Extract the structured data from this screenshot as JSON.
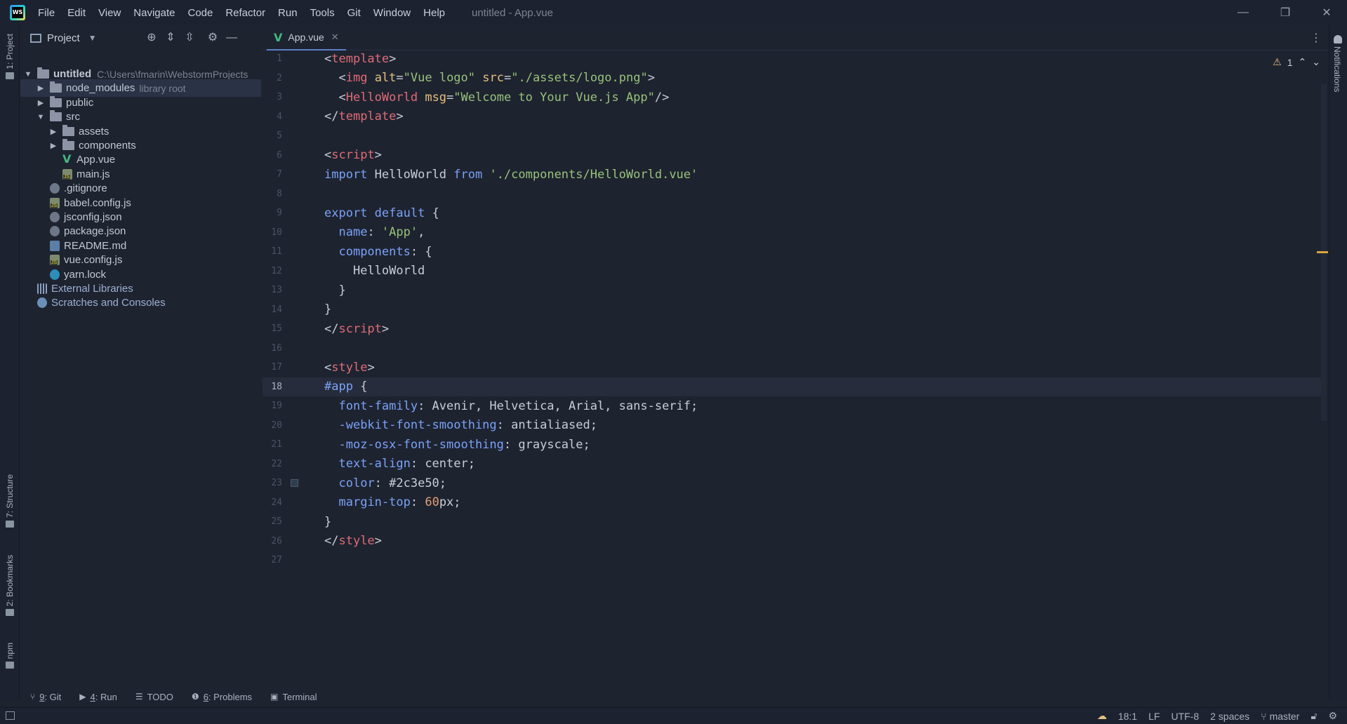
{
  "window": {
    "title": "untitled - App.vue",
    "menu": [
      "File",
      "Edit",
      "View",
      "Navigate",
      "Code",
      "Refactor",
      "Run",
      "Tools",
      "Git",
      "Window",
      "Help"
    ],
    "controls": {
      "minimize": "—",
      "restore": "❐",
      "close": "✕"
    }
  },
  "left_strip": {
    "project": "1: Project",
    "structure": "7: Structure",
    "bookmarks": "2: Bookmarks",
    "npm": "npm"
  },
  "project_panel": {
    "title": "Project",
    "tree": [
      {
        "label": "untitled",
        "extra": "C:\\Users\\fmarin\\WebstormProjects",
        "type": "folder",
        "depth": 0,
        "expanded": true
      },
      {
        "label": "node_modules",
        "extra": "library root",
        "type": "folder",
        "depth": 1,
        "expanded": false,
        "selected": true
      },
      {
        "label": "public",
        "type": "folder",
        "depth": 1,
        "expanded": false
      },
      {
        "label": "src",
        "type": "folder",
        "depth": 1,
        "expanded": true
      },
      {
        "label": "assets",
        "type": "folder",
        "depth": 2,
        "expanded": false
      },
      {
        "label": "components",
        "type": "folder",
        "depth": 2,
        "expanded": false
      },
      {
        "label": "App.vue",
        "type": "vue",
        "depth": 2
      },
      {
        "label": "main.js",
        "type": "js",
        "depth": 2
      },
      {
        "label": ".gitignore",
        "type": "cfg",
        "depth": 1
      },
      {
        "label": "babel.config.js",
        "type": "js",
        "depth": 1
      },
      {
        "label": "jsconfig.json",
        "type": "cfg",
        "depth": 1
      },
      {
        "label": "package.json",
        "type": "cfg",
        "depth": 1
      },
      {
        "label": "README.md",
        "type": "md",
        "depth": 1
      },
      {
        "label": "vue.config.js",
        "type": "js",
        "depth": 1
      },
      {
        "label": "yarn.lock",
        "type": "yarn",
        "depth": 1
      },
      {
        "label": "External Libraries",
        "type": "lib",
        "depth": 0
      },
      {
        "label": "Scratches and Consoles",
        "type": "scratch",
        "depth": 0
      }
    ]
  },
  "editor": {
    "tab_label": "App.vue",
    "inspection_count": "1",
    "current_line": 18,
    "lines": [
      [
        [
          "tok-br",
          "<"
        ],
        [
          "tok-tag",
          "template"
        ],
        [
          "tok-br",
          ">"
        ]
      ],
      [
        [
          "tok-br",
          "  <"
        ],
        [
          "tok-tag",
          "img"
        ],
        [
          "tok-br",
          " "
        ],
        [
          "tok-attr",
          "alt"
        ],
        [
          "tok-br",
          "="
        ],
        [
          "tok-str",
          "\"Vue logo\""
        ],
        [
          "tok-br",
          " "
        ],
        [
          "tok-attr",
          "src"
        ],
        [
          "tok-br",
          "="
        ],
        [
          "tok-str",
          "\"./assets/logo.png\""
        ],
        [
          "tok-br",
          ">"
        ]
      ],
      [
        [
          "tok-br",
          "  <"
        ],
        [
          "tok-tag",
          "HelloWorld"
        ],
        [
          "tok-br",
          " "
        ],
        [
          "tok-attr",
          "msg"
        ],
        [
          "tok-br",
          "="
        ],
        [
          "tok-str",
          "\"Welcome to Your Vue.js App\""
        ],
        [
          "tok-br",
          "/>"
        ]
      ],
      [
        [
          "tok-br",
          "</"
        ],
        [
          "tok-tag",
          "template"
        ],
        [
          "tok-br",
          ">"
        ]
      ],
      [],
      [
        [
          "tok-br",
          "<"
        ],
        [
          "tok-tag",
          "script"
        ],
        [
          "tok-br",
          ">"
        ]
      ],
      [
        [
          "tok-kw",
          "import"
        ],
        [
          "tok-br",
          " HelloWorld "
        ],
        [
          "tok-kw",
          "from"
        ],
        [
          "tok-br",
          " "
        ],
        [
          "tok-str",
          "'./components/HelloWorld.vue'"
        ]
      ],
      [],
      [
        [
          "tok-kw",
          "export"
        ],
        [
          "tok-br",
          " "
        ],
        [
          "tok-kw",
          "default"
        ],
        [
          "tok-br",
          " {"
        ]
      ],
      [
        [
          "tok-br",
          "  "
        ],
        [
          "tok-prop",
          "name"
        ],
        [
          "tok-br",
          ": "
        ],
        [
          "tok-str",
          "'App'"
        ],
        [
          "tok-br",
          ","
        ]
      ],
      [
        [
          "tok-br",
          "  "
        ],
        [
          "tok-prop",
          "components"
        ],
        [
          "tok-br",
          ": {"
        ]
      ],
      [
        [
          "tok-br",
          "    HelloWorld"
        ]
      ],
      [
        [
          "tok-br",
          "  }"
        ]
      ],
      [
        [
          "tok-br",
          "}"
        ]
      ],
      [
        [
          "tok-br",
          "</"
        ],
        [
          "tok-tag",
          "script"
        ],
        [
          "tok-br",
          ">"
        ]
      ],
      [],
      [
        [
          "tok-br",
          "<"
        ],
        [
          "tok-tag",
          "style"
        ],
        [
          "tok-br",
          ">"
        ]
      ],
      [
        [
          "tok-sel",
          "#app"
        ],
        [
          "tok-br",
          " {"
        ]
      ],
      [
        [
          "tok-br",
          "  "
        ],
        [
          "tok-prop",
          "font-family"
        ],
        [
          "tok-br",
          ": Avenir, Helvetica, Arial, sans-serif;"
        ]
      ],
      [
        [
          "tok-br",
          "  "
        ],
        [
          "tok-prop",
          "-webkit-font-smoothing"
        ],
        [
          "tok-br",
          ": antialiased;"
        ]
      ],
      [
        [
          "tok-br",
          "  "
        ],
        [
          "tok-prop",
          "-moz-osx-font-smoothing"
        ],
        [
          "tok-br",
          ": grayscale;"
        ]
      ],
      [
        [
          "tok-br",
          "  "
        ],
        [
          "tok-prop",
          "text-align"
        ],
        [
          "tok-br",
          ": center;"
        ]
      ],
      [
        [
          "tok-br",
          "  "
        ],
        [
          "tok-prop",
          "color"
        ],
        [
          "tok-br",
          ": #2c3e50;"
        ]
      ],
      [
        [
          "tok-br",
          "  "
        ],
        [
          "tok-prop",
          "margin-top"
        ],
        [
          "tok-br",
          ": "
        ],
        [
          "tok-num",
          "60"
        ],
        [
          "tok-br",
          "px;"
        ]
      ],
      [
        [
          "tok-br",
          "}"
        ]
      ],
      [
        [
          "tok-br",
          "</"
        ],
        [
          "tok-tag",
          "style"
        ],
        [
          "tok-br",
          ">"
        ]
      ],
      []
    ]
  },
  "right_strip": {
    "notifications": "Notifications"
  },
  "tool_windows": [
    {
      "num": "9",
      "label": ": Git",
      "icon": "git-icon",
      "glyph": "⑂"
    },
    {
      "num": "4",
      "label": ": Run",
      "icon": "run-icon",
      "glyph": "▶"
    },
    {
      "num": "",
      "label": "TODO",
      "icon": "todo-icon",
      "glyph": "☰"
    },
    {
      "num": "6",
      "label": ": Problems",
      "icon": "problems-icon",
      "glyph": "❶"
    },
    {
      "num": "",
      "label": "Terminal",
      "icon": "terminal-icon",
      "glyph": "▣"
    }
  ],
  "status": {
    "position": "18:1",
    "line_sep": "LF",
    "encoding": "UTF-8",
    "indent": "2 spaces",
    "branch": "master"
  }
}
